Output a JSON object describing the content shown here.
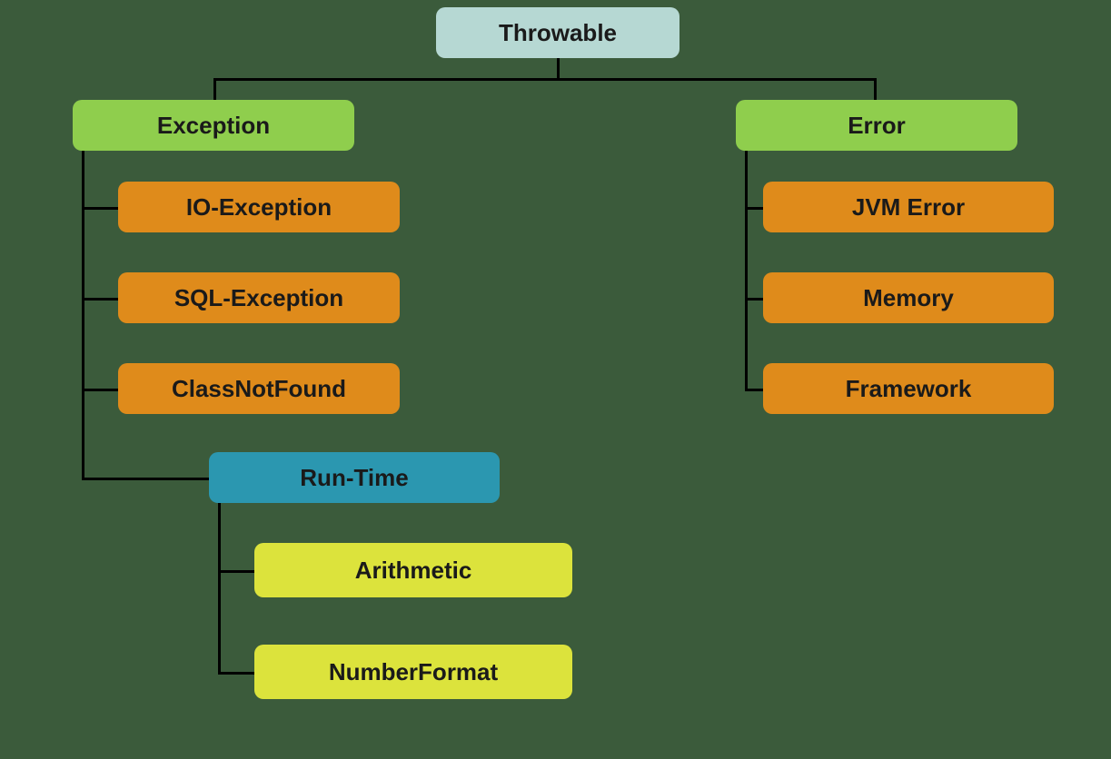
{
  "root": {
    "label": "Throwable"
  },
  "left": {
    "label": "Exception",
    "children": [
      {
        "label": "IO-Exception"
      },
      {
        "label": "SQL-Exception"
      },
      {
        "label": "ClassNotFound"
      },
      {
        "label": "Run-Time",
        "children": [
          {
            "label": "Arithmetic"
          },
          {
            "label": "NumberFormat"
          }
        ]
      }
    ]
  },
  "right": {
    "label": "Error",
    "children": [
      {
        "label": "JVM Error"
      },
      {
        "label": "Memory"
      },
      {
        "label": "Framework"
      }
    ]
  }
}
